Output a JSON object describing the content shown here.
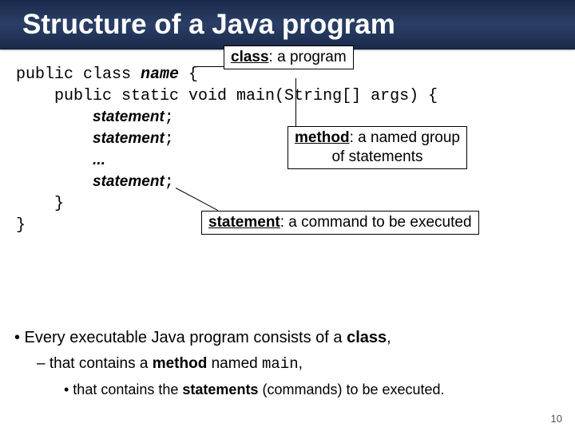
{
  "title": "Structure of a Java program",
  "code": {
    "l1a": "public class ",
    "l1b": "name",
    "l1c": " {",
    "l2": "    public static void main(String[] args) {",
    "l3a": "        ",
    "l3b": "statement",
    "l3c": ";",
    "l4a": "        ",
    "l4b": "statement",
    "l4c": ";",
    "l5a": "        ",
    "l5b": "...",
    "l6a": "        ",
    "l6b": "statement",
    "l6c": ";",
    "l7": "    }",
    "l8": "}"
  },
  "callouts": {
    "c1a": "class",
    "c1b": ": a program",
    "c2a": "method",
    "c2b": ": a named group",
    "c2c": "of statements",
    "c3a": "statement",
    "c3b": ": a command to be executed"
  },
  "bullets": {
    "b1a": "• Every executable Java program consists of a ",
    "b1b": "class",
    "b1c": ",",
    "b2a": "– that contains a ",
    "b2b": "method",
    "b2c": " named ",
    "b2d": "main",
    "b2e": ",",
    "b3a": "• that contains the ",
    "b3b": "statements",
    "b3c": " (commands) to be executed."
  },
  "page": "10"
}
